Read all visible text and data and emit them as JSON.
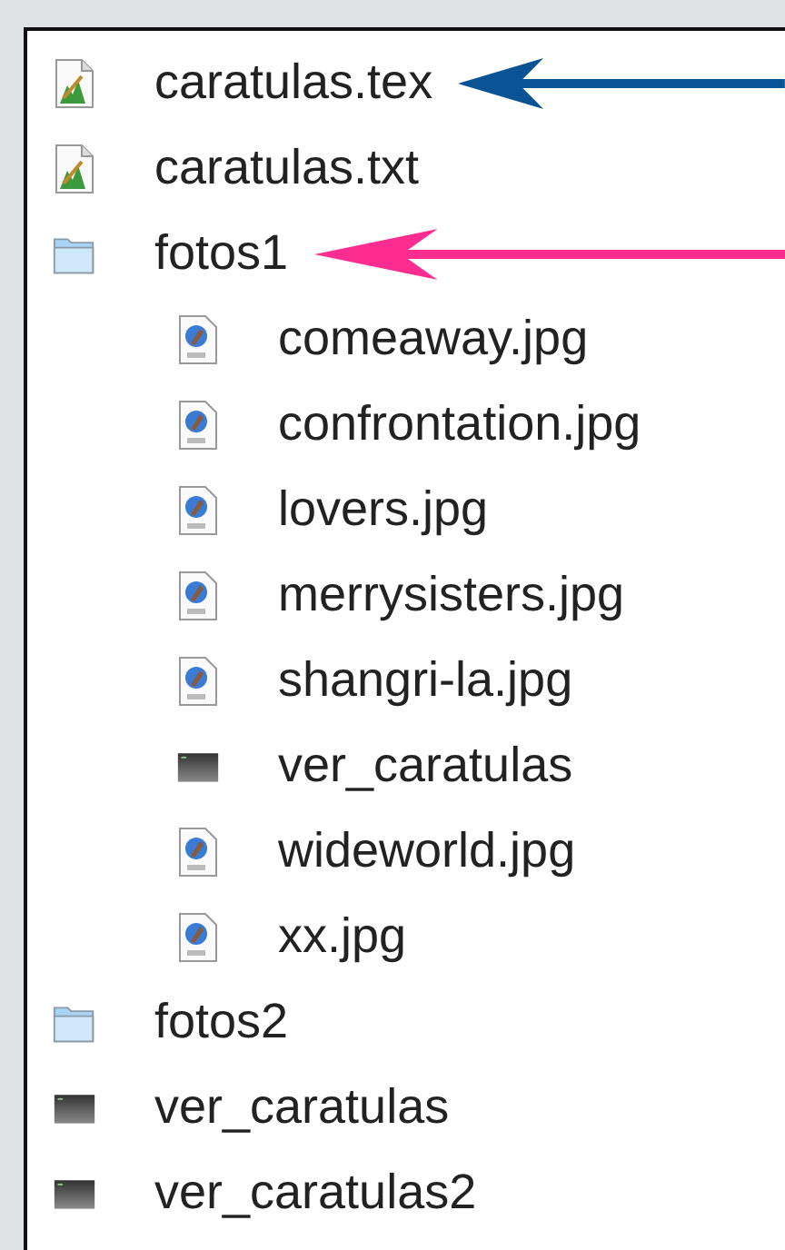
{
  "files": [
    {
      "name": "caratulas.tex",
      "kind": "document",
      "arrow": {
        "color": "#0a5394"
      }
    },
    {
      "name": "caratulas.txt",
      "kind": "document"
    },
    {
      "name": "fotos1",
      "kind": "folder",
      "arrow": {
        "color": "#ff2d8f"
      },
      "children": [
        {
          "name": "comeaway.jpg",
          "kind": "image"
        },
        {
          "name": "confrontation.jpg",
          "kind": "image"
        },
        {
          "name": "lovers.jpg",
          "kind": "image"
        },
        {
          "name": "merrysisters.jpg",
          "kind": "image"
        },
        {
          "name": "shangri-la.jpg",
          "kind": "image"
        },
        {
          "name": "ver_caratulas",
          "kind": "executable"
        },
        {
          "name": "wideworld.jpg",
          "kind": "image"
        },
        {
          "name": "xx.jpg",
          "kind": "image"
        }
      ]
    },
    {
      "name": "fotos2",
      "kind": "folder"
    },
    {
      "name": "ver_caratulas",
      "kind": "executable"
    },
    {
      "name": "ver_caratulas2",
      "kind": "executable"
    }
  ]
}
